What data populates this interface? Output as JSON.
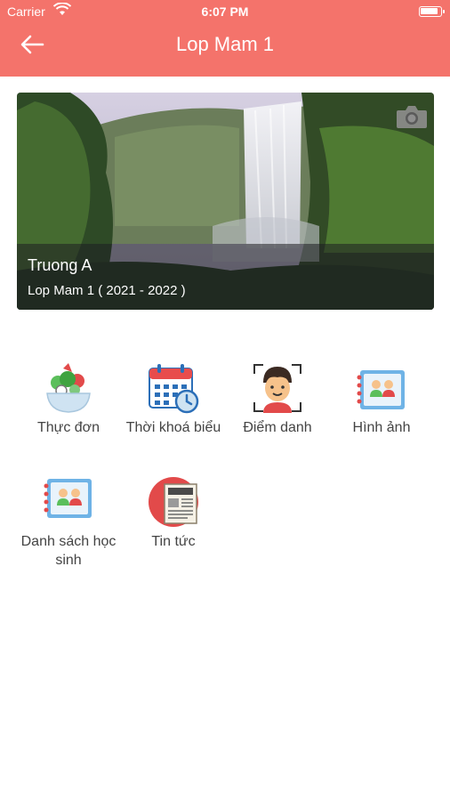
{
  "status_bar": {
    "carrier": "Carrier",
    "time": "6:07 PM"
  },
  "header": {
    "title": "Lop Mam 1"
  },
  "banner": {
    "school": "Truong A",
    "class_label": "Lop Mam 1 ( 2021 - 2022 )"
  },
  "menu": [
    {
      "label": "Thực đơn",
      "icon": "salad-bowl-icon"
    },
    {
      "label": "Thời khoá biểu",
      "icon": "calendar-clock-icon"
    },
    {
      "label": "Điểm danh",
      "icon": "face-scan-icon"
    },
    {
      "label": "Hình ảnh",
      "icon": "photo-album-icon"
    },
    {
      "label": "Danh sách học sinh",
      "icon": "student-album-icon"
    },
    {
      "label": "Tin tức",
      "icon": "newspaper-icon"
    }
  ],
  "colors": {
    "header": "#f4736b",
    "text": "#444444"
  }
}
